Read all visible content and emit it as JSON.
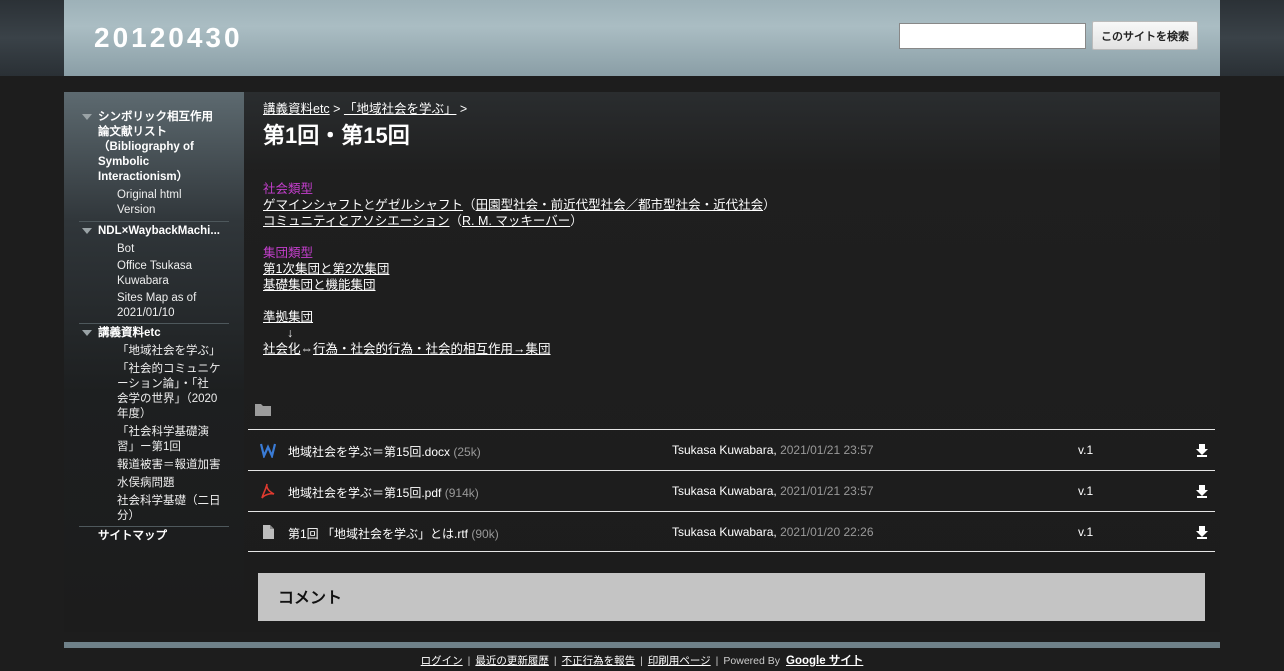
{
  "header": {
    "site_title": "20120430",
    "search_value": "",
    "search_button": "このサイトを検索"
  },
  "sidebar": {
    "groups": [
      {
        "title_lines": [
          "シンボリック相互作用",
          "論文献リスト",
          "（Bibliography of",
          "Symbolic",
          "Interactionism）"
        ],
        "items": [
          {
            "lines": [
              "Original html",
              "Version"
            ]
          }
        ]
      },
      {
        "title_lines": [
          "NDL×WaybackMachi..."
        ],
        "items": [
          {
            "lines": [
              "Bot"
            ]
          },
          {
            "lines": [
              "Office Tsukasa",
              "Kuwabara"
            ]
          },
          {
            "lines": [
              "Sites Map as of",
              "2021/01/10"
            ]
          }
        ]
      },
      {
        "title_lines": [
          "講義資料etc"
        ],
        "items": [
          {
            "lines": [
              "「地域社会を学ぶ」"
            ]
          },
          {
            "lines": [
              "「社会的コミュニケ",
              "ーション論」・「社",
              "会学の世界」（2020",
              "年度）"
            ]
          },
          {
            "lines": [
              "「社会科学基礎演",
              "習」ー第1回"
            ]
          },
          {
            "lines": [
              "報道被害＝報道加害"
            ]
          },
          {
            "lines": [
              "水俣病問題"
            ]
          },
          {
            "lines": [
              "社会科学基礎（二日",
              "分）"
            ]
          }
        ]
      }
    ],
    "sitemap": "サイトマップ"
  },
  "breadcrumb": {
    "crumb1": "講義資料etc",
    "sep1": " > ",
    "crumb2": "「地域社会を学ぶ」",
    "sep2": " >"
  },
  "page_title": "第1回・第15回",
  "content": {
    "section1_heading": "社会類型",
    "s1_line1": {
      "link_a": "ゲマインシャフト",
      "and": "と",
      "link_b": "ゲゼルシャフト",
      "open": "（",
      "link_c": "田園型社会・前近代型社会／都市型社会・近代社会",
      "close": "）"
    },
    "s1_line2": {
      "link_a": "コミュニティとアソシエーション",
      "open": "（",
      "link_b": "R. M. マッキーバー",
      "close": "）"
    },
    "section2_heading": "集団類型",
    "s2_line1": "第1次集団と第2次集団",
    "s2_line2": "基礎集団と機能集団",
    "s3_line1": "準拠集団",
    "arrow": "↓",
    "s3_line3": {
      "link_a": "社会化",
      "sym": "⇔",
      "link_b": "行為・社会的行為・社会的相互作用→集団"
    }
  },
  "files": [
    {
      "icon": "word-icon",
      "name": "地域社会を学ぶ＝第15回.docx",
      "size": "(25k)",
      "author": "Tsukasa Kuwabara,",
      "date": "2021/01/21 23:57",
      "version": "v.1"
    },
    {
      "icon": "pdf-icon",
      "name": "地域社会を学ぶ＝第15回.pdf",
      "size": "(914k)",
      "author": "Tsukasa Kuwabara,",
      "date": "2021/01/21 23:57",
      "version": "v.1"
    },
    {
      "icon": "document-icon",
      "name": "第1回 「地域社会を学ぶ」とは.rtf",
      "size": "(90k)",
      "author": "Tsukasa Kuwabara,",
      "date": "2021/01/20 22:26",
      "version": "v.1"
    }
  ],
  "comments_title": "コメント",
  "footer": {
    "login": "ログイン",
    "recent": "最近の更新履歴",
    "report": "不正行為を報告",
    "print": "印刷用ページ",
    "powered": "Powered By",
    "brand": "Google サイト"
  },
  "colors": {
    "header_bg": "#aabdc3",
    "magenta_heading": "#c33ecc",
    "comments_bg": "#c4c4c4",
    "footer_bar": "#6f8189"
  }
}
